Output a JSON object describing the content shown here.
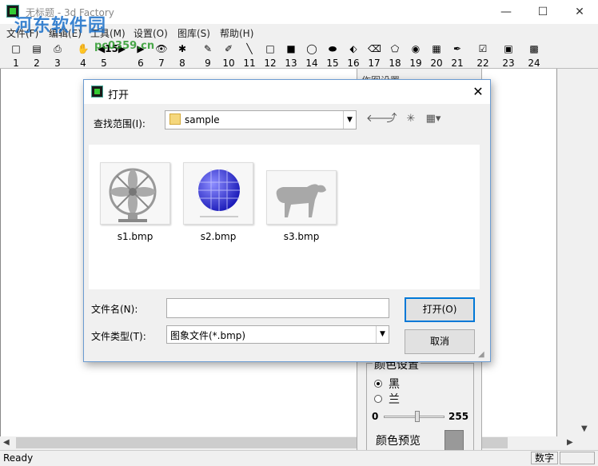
{
  "window": {
    "title": "无标题 - 3d Factory",
    "minimize_glyph": "—",
    "maximize_glyph": "☐",
    "close_glyph": "✕"
  },
  "watermark": {
    "text": "河东软件园",
    "url": "pc0359.cn"
  },
  "menu": {
    "items": [
      "文件(F)",
      "编辑(E)",
      "工具(M)",
      "设置(O)",
      "图库(S)",
      "帮助(H)"
    ]
  },
  "toolbar": {
    "tools": [
      {
        "num": "1",
        "icon": "new-doc-icon",
        "glyph": "□"
      },
      {
        "num": "2",
        "icon": "open-icon",
        "glyph": "▤"
      },
      {
        "num": "3",
        "icon": "print-icon",
        "glyph": "⎙"
      },
      {
        "num": "4",
        "icon": "hand-icon",
        "glyph": "✋"
      },
      {
        "num": "5",
        "icon": "arrows-icon",
        "glyph": "◀15▶"
      },
      {
        "num": "6",
        "icon": "right-arrow-icon",
        "glyph": "▶"
      },
      {
        "num": "7",
        "icon": "eye-icon",
        "glyph": "👁"
      },
      {
        "num": "8",
        "icon": "bug-icon",
        "glyph": "✱"
      },
      {
        "num": "9",
        "icon": "pencil-icon",
        "glyph": "✎"
      },
      {
        "num": "10",
        "icon": "brush-icon",
        "glyph": "✐"
      },
      {
        "num": "11",
        "icon": "line-icon",
        "glyph": "╲"
      },
      {
        "num": "12",
        "icon": "rect-icon",
        "glyph": "□"
      },
      {
        "num": "13",
        "icon": "filled-rect-icon",
        "glyph": "■"
      },
      {
        "num": "14",
        "icon": "ellipse-icon",
        "glyph": "◯"
      },
      {
        "num": "15",
        "icon": "filled-ellipse-icon",
        "glyph": "⬬"
      },
      {
        "num": "16",
        "icon": "fill-icon",
        "glyph": "⬖"
      },
      {
        "num": "17",
        "icon": "eraser-icon",
        "glyph": "⌫"
      },
      {
        "num": "18",
        "icon": "polygon-icon",
        "glyph": "⬠"
      },
      {
        "num": "19",
        "icon": "circle-dot-icon",
        "glyph": "◉"
      },
      {
        "num": "20",
        "icon": "grid-icon",
        "glyph": "▦"
      },
      {
        "num": "21",
        "icon": "picker-icon",
        "glyph": "✒"
      },
      {
        "num": "22",
        "icon": "check-icon",
        "glyph": "☑"
      },
      {
        "num": "23",
        "icon": "save-icon",
        "glyph": "▣"
      },
      {
        "num": "24",
        "icon": "palette-icon",
        "glyph": "▩"
      }
    ]
  },
  "side_panel": {
    "title": "作图设置",
    "color_group_title": "颜色设置",
    "radio_black": "黑",
    "radio_blue": "兰",
    "slider_min": "0",
    "slider_max": "255",
    "slider_value_fraction": 0.55,
    "preview_label": "颜色预览",
    "preview_color": "#999999"
  },
  "status": {
    "text": "Ready",
    "num_indicator": "数字"
  },
  "dialog": {
    "title": "打开",
    "close_glyph": "✕",
    "lookin_label": "查找范围(I):",
    "lookin_value": "sample",
    "nav_back": "🡐",
    "nav_up": "⤴",
    "nav_newfolder": "✳",
    "nav_view": "▦▾",
    "files": [
      {
        "name": "s1.bmp"
      },
      {
        "name": "s2.bmp"
      },
      {
        "name": "s3.bmp"
      }
    ],
    "filename_label": "文件名(N):",
    "filename_value": "",
    "filetype_label": "文件类型(T):",
    "filetype_value": "图象文件(*.bmp)",
    "open_button": "打开(O)",
    "cancel_button": "取消",
    "combo_arrow": "▼"
  },
  "colors": {
    "accent": "#0078d7",
    "canvas": "#ffffff"
  }
}
